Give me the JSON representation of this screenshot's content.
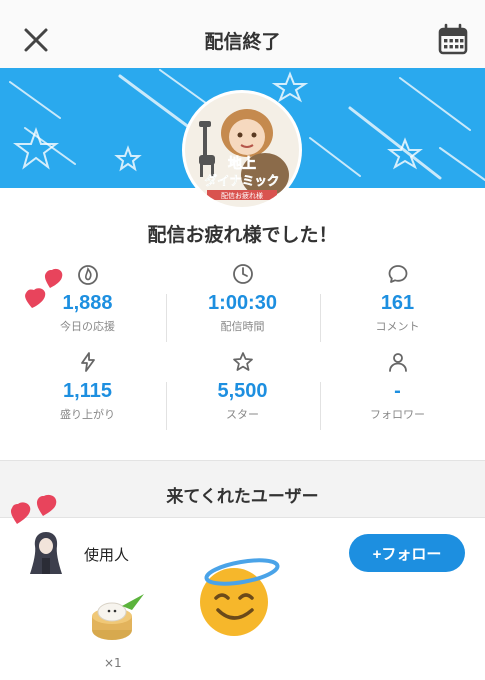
{
  "header": {
    "title": "配信終了",
    "close_icon": "close-icon",
    "calendar_icon": "calendar-icon"
  },
  "avatar_logo": {
    "line1": "地上",
    "line2": "ダイナミック",
    "line3": "配信お疲れ様"
  },
  "greeting": "配信お疲れ様でした！",
  "stats": [
    {
      "icon": "flame-icon",
      "value": "1,888",
      "label": "今日の応援"
    },
    {
      "icon": "clock-icon",
      "value": "1:00:30",
      "label": "配信時間"
    },
    {
      "icon": "comment-icon",
      "value": "161",
      "label": "コメント"
    },
    {
      "icon": "lightning-icon",
      "value": "1,115",
      "label": "盛り上がり"
    },
    {
      "icon": "star-icon",
      "value": "5,500",
      "label": "スター"
    },
    {
      "icon": "person-icon",
      "value": "-",
      "label": "フォロワー"
    }
  ],
  "visitors_section": {
    "title": "来てくれたユーザー",
    "user": {
      "name": "使用人",
      "follow_label": "+フォロー"
    },
    "gift_count": "×1"
  },
  "colors": {
    "accent": "#1d8fe0",
    "banner": "#2aa9ee",
    "heart": "#e8445c"
  }
}
